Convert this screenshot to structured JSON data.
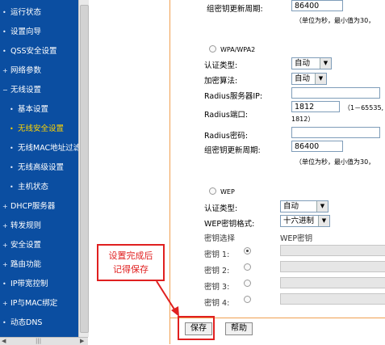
{
  "sidebar": {
    "items": [
      {
        "label": "运行状态"
      },
      {
        "label": "设置向导"
      },
      {
        "label": "QSS安全设置"
      },
      {
        "label": "网络参数"
      },
      {
        "label": "无线设置"
      },
      {
        "label": "基本设置"
      },
      {
        "label": "无线安全设置"
      },
      {
        "label": "无线MAC地址过滤"
      },
      {
        "label": "无线高级设置"
      },
      {
        "label": "主机状态"
      },
      {
        "label": "DHCP服务器"
      },
      {
        "label": "转发规则"
      },
      {
        "label": "安全设置"
      },
      {
        "label": "路由功能"
      },
      {
        "label": "IP带宽控制"
      },
      {
        "label": "IP与MAC绑定"
      },
      {
        "label": "动态DNS"
      }
    ]
  },
  "top": {
    "key_period_label": "组密钥更新周期:",
    "key_period_value": "86400",
    "note": "（单位为秒，最小值为30，"
  },
  "wpa": {
    "radio_label": "WPA/WPA2",
    "auth_label": "认证类型:",
    "auth_value": "自动",
    "enc_label": "加密算法:",
    "enc_value": "自动",
    "radius_ip_label": "Radius服务器IP:",
    "radius_port_label": "Radius端口:",
    "radius_port_value": "1812",
    "radius_port_hint": "（1－65535,",
    "radius_port_hint2": "1812）",
    "radius_pwd_label": "Radius密码:",
    "key_period_label": "组密钥更新周期:",
    "key_period_value": "86400",
    "note": "（单位为秒，最小值为30，"
  },
  "wep": {
    "radio_label": "WEP",
    "auth_label": "认证类型:",
    "auth_value": "自动",
    "format_label": "WEP密钥格式:",
    "format_value": "十六进制",
    "key_select_label": "密钥选择",
    "wep_key_header": "WEP密钥",
    "keys": [
      {
        "label": "密钥 1:"
      },
      {
        "label": "密钥 2:"
      },
      {
        "label": "密钥 3:"
      },
      {
        "label": "密钥 4:"
      }
    ]
  },
  "buttons": {
    "save": "保存",
    "help": "帮助"
  },
  "annotation": {
    "line1": "设置完成后",
    "line2": "记得保存",
    "color": "#e02020"
  },
  "colors": {
    "sidebar_bg": "#0b4ea1",
    "active_item": "#ffd400",
    "content_border": "#f0a050"
  }
}
